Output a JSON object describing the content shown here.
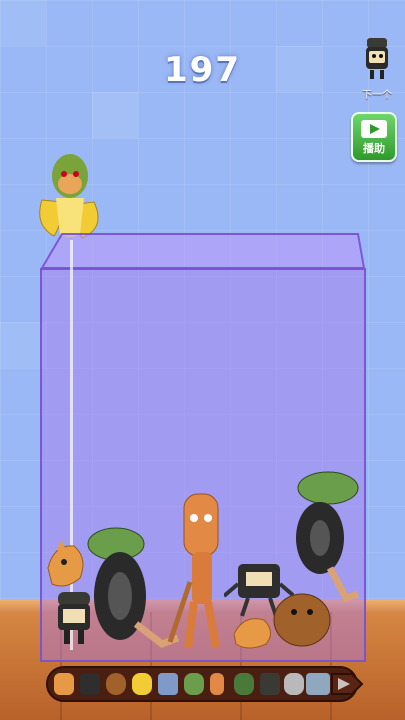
{
  "score": "197",
  "next": {
    "label": "下一个",
    "icon": "next-creature-icon"
  },
  "ad_button": {
    "label": "播助",
    "icon": "play-video-icon"
  },
  "dropper": {
    "creature": "banana-monkey"
  },
  "container": {
    "creatures": [
      "cat-fish",
      "helmet-soldier",
      "frog-tire",
      "frog-tire",
      "baguette-man",
      "robot-box",
      "capybara",
      "cat-fish"
    ]
  },
  "evolution_tray": {
    "items": [
      "cat-fish",
      "robot-box",
      "capybara",
      "banana",
      "shark-sneaker",
      "frog",
      "baguette",
      "frog-tire",
      "helmet",
      "pigeon",
      "crocodile-plane",
      "shark"
    ],
    "arrow_icon": "arrow-right-icon"
  },
  "colors": {
    "background": "#9ab8f5",
    "glass": "#aa78f0",
    "floor": "#c77435",
    "score": "#ffffff"
  }
}
